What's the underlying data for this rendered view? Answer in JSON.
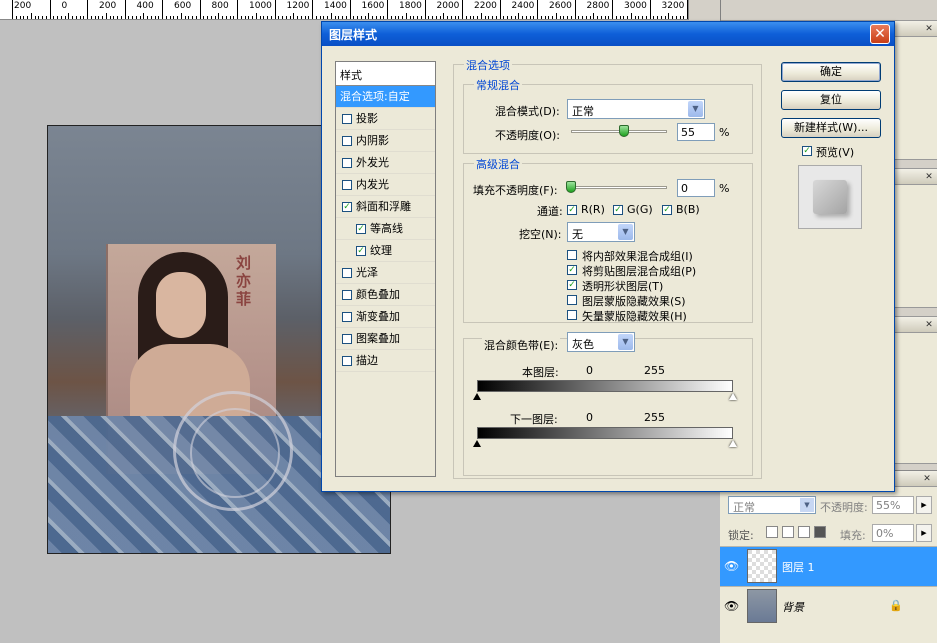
{
  "ruler": {
    "labels": [
      "200",
      "0",
      "200",
      "400",
      "600",
      "800",
      "1000",
      "1200",
      "1400",
      "1600",
      "1800",
      "2000",
      "2200",
      "2400",
      "2600",
      "2800",
      "3000",
      "3200"
    ]
  },
  "dialog": {
    "title": "图层样式",
    "close_label": "✕",
    "styles_header": "样式",
    "styles": [
      {
        "label": "混合选项:自定",
        "selected": true,
        "checked": null,
        "sub": false
      },
      {
        "label": "投影",
        "checked": false,
        "sub": false
      },
      {
        "label": "内阴影",
        "checked": false,
        "sub": false
      },
      {
        "label": "外发光",
        "checked": false,
        "sub": false
      },
      {
        "label": "内发光",
        "checked": false,
        "sub": false
      },
      {
        "label": "斜面和浮雕",
        "checked": true,
        "sub": false
      },
      {
        "label": "等高线",
        "checked": true,
        "sub": true
      },
      {
        "label": "纹理",
        "checked": true,
        "sub": true
      },
      {
        "label": "光泽",
        "checked": false,
        "sub": false
      },
      {
        "label": "颜色叠加",
        "checked": false,
        "sub": false
      },
      {
        "label": "渐变叠加",
        "checked": false,
        "sub": false
      },
      {
        "label": "图案叠加",
        "checked": false,
        "sub": false
      },
      {
        "label": "描边",
        "checked": false,
        "sub": false
      }
    ],
    "blending_options": "混合选项",
    "general": {
      "legend": "常规混合",
      "mode_label": "混合模式(D):",
      "mode_value": "正常",
      "opacity_label": "不透明度(O):",
      "opacity_value": "55",
      "opacity_percent": 0.55,
      "unit": "%"
    },
    "advanced": {
      "legend": "高级混合",
      "fill_label": "填充不透明度(F):",
      "fill_value": "0",
      "fill_percent": 0,
      "unit": "%",
      "channels_label": "通道:",
      "channels": [
        {
          "label": "R(R)",
          "checked": true
        },
        {
          "label": "G(G)",
          "checked": true
        },
        {
          "label": "B(B)",
          "checked": true
        }
      ],
      "knockout_label": "挖空(N):",
      "knockout_value": "无",
      "options": [
        {
          "label": "将内部效果混合成组(I)",
          "checked": false
        },
        {
          "label": "将剪贴图层混合成组(P)",
          "checked": true
        },
        {
          "label": "透明形状图层(T)",
          "checked": true
        },
        {
          "label": "图层蒙版隐藏效果(S)",
          "checked": false
        },
        {
          "label": "矢量蒙版隐藏效果(H)",
          "checked": false
        }
      ]
    },
    "blend_if": {
      "label": "混合颜色带(E):",
      "value": "灰色",
      "this_layer_label": "本图层:",
      "this_layer_low": "0",
      "this_layer_high": "255",
      "below_label": "下一图层:",
      "below_low": "0",
      "below_high": "255"
    },
    "buttons": {
      "ok": "确定",
      "reset": "复位",
      "new_style": "新建样式(W)...",
      "preview": "预览(V)",
      "preview_checked": true
    }
  },
  "layers_panel": {
    "blend_mode": "正常",
    "opacity_label": "不透明度:",
    "opacity_value": "55%",
    "lock_label": "锁定:",
    "fill_label": "填充:",
    "fill_value": "0%",
    "layers": [
      {
        "name": "图层 1",
        "selected": true
      },
      {
        "name": "背景",
        "selected": false
      }
    ]
  },
  "document": {
    "poster_text": "刘亦菲"
  }
}
